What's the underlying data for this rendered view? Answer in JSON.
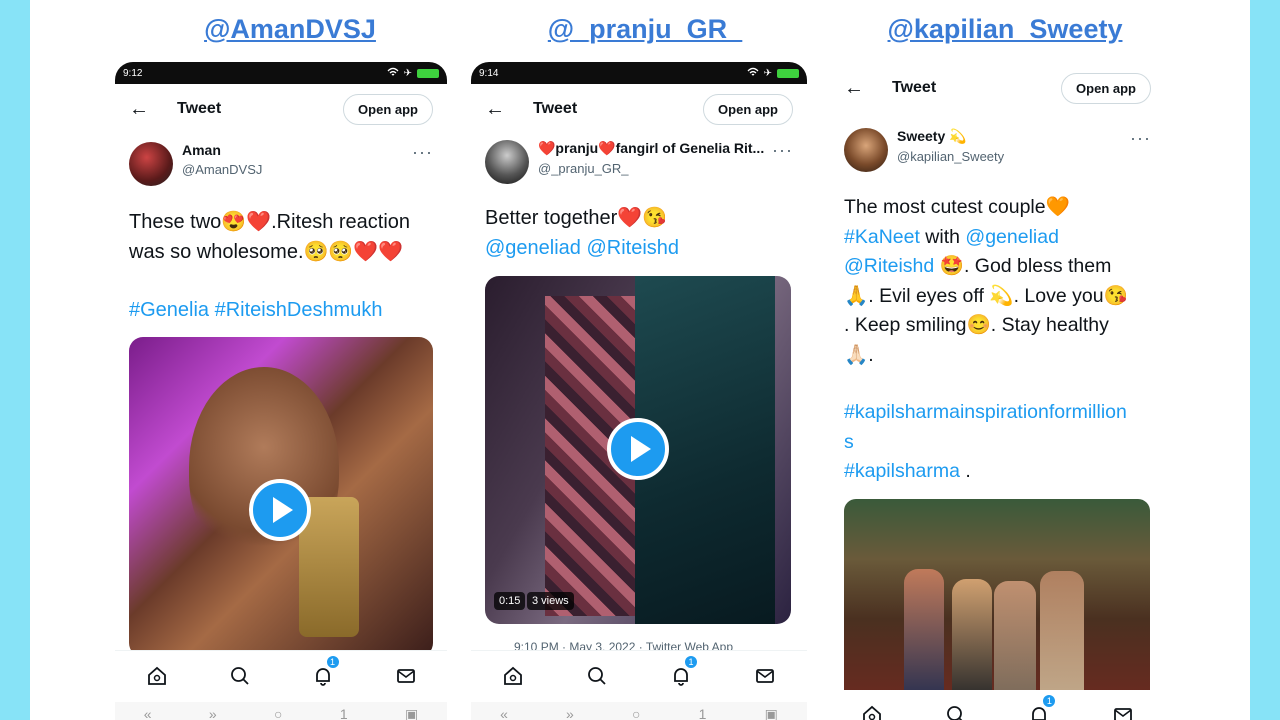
{
  "columns": [
    {
      "handle_header": "@AmanDVSJ",
      "status_time": "9:12",
      "topbar": {
        "title": "Tweet",
        "open_app": "Open app"
      },
      "author": {
        "name": "Aman",
        "handle": "@AmanDVSJ"
      },
      "tweet_text_line1": "These two😍❤️.Ritesh reaction",
      "tweet_text_line2": "was so wholesome.🥺🥺❤️❤️",
      "hashtags": "#Genelia #RiteishDeshmukh",
      "nav": {
        "notifications_count": "1",
        "sysnav_count": "1"
      }
    },
    {
      "handle_header": "@_pranju_GR_",
      "status_time": "9:14",
      "topbar": {
        "title": "Tweet",
        "open_app": "Open app"
      },
      "author": {
        "name": "❤️pranju❤️fangirl of Genelia Rit...",
        "handle": "@_pranju_GR_"
      },
      "tweet_text_line1": "Better together❤️😘",
      "mentions": "@geneliad @Riteishd",
      "video_time": "0:15",
      "video_views": "3 views",
      "timestamp": "9:10 PM · May 3, 2022 · Twitter Web App",
      "nav": {
        "notifications_count": "1",
        "sysnav_count": "1"
      }
    },
    {
      "handle_header": "@kapilian_Sweety",
      "topbar": {
        "title": "Tweet",
        "open_app": "Open app"
      },
      "author": {
        "name": "Sweety 💫",
        "handle": "@kapilian_Sweety"
      },
      "line1": "The most cutest couple🧡",
      "line2_tag": "#KaNeet",
      "line2_mid": " with ",
      "line2_mention": "@geneliad",
      "line3_mention": "@Riteishd",
      "line3_rest": " 🤩. God bless them",
      "line4": "🙏. Evil eyes off 💫. Love you😘",
      "line5": ". Keep smiling😊. Stay healthy",
      "line6": "🙏🏻.",
      "tag_long": "#kapilsharmainspirationformillion",
      "tag_long_tail": "s",
      "tag_kapil": "#kapilsharma",
      "tag_kapil_tail": " .",
      "nav": {
        "notifications_count": "1"
      }
    }
  ],
  "colors": {
    "background": "#87e3f7",
    "link": "#1d9bf0",
    "header_handle": "#3a7bd5"
  },
  "icons": [
    "back-arrow-icon",
    "more-icon",
    "play-icon",
    "home-icon",
    "search-icon",
    "bell-icon",
    "mail-icon",
    "wifi-icon",
    "battery-icon"
  ]
}
